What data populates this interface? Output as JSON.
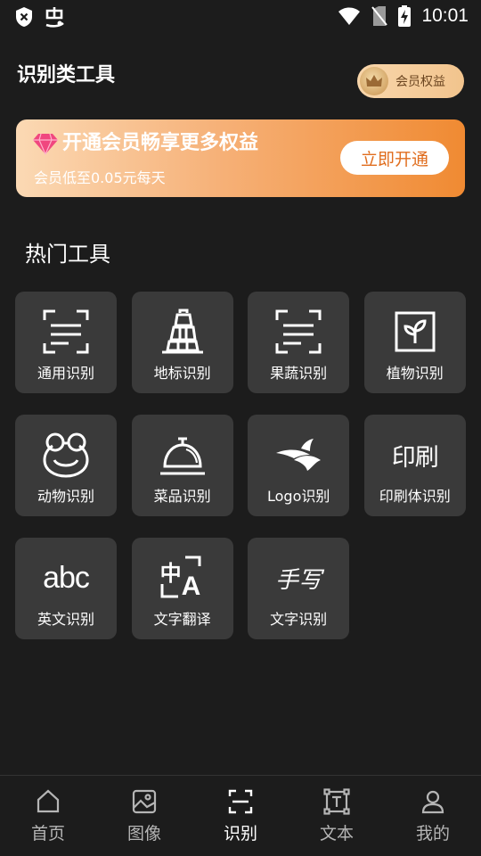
{
  "status_bar": {
    "time": "10:01"
  },
  "header": {
    "title": "识别类工具",
    "member_label": "会员权益"
  },
  "vip_banner": {
    "title": "开通会员畅享更多权益",
    "subtitle": "会员低至0.05元每天",
    "button": "立即开通"
  },
  "section_title": "热门工具",
  "tools": [
    {
      "label": "通用识别",
      "icon": "scan-text-icon"
    },
    {
      "label": "地标识别",
      "icon": "tower-icon"
    },
    {
      "label": "果蔬识别",
      "icon": "scan-text-icon"
    },
    {
      "label": "植物识别",
      "icon": "plant-icon"
    },
    {
      "label": "动物识别",
      "icon": "frog-icon"
    },
    {
      "label": "菜品识别",
      "icon": "dish-cloche-icon"
    },
    {
      "label": "Logo识别",
      "icon": "logo-bird-icon"
    },
    {
      "label": "印刷体识别",
      "icon": "print-text-icon"
    },
    {
      "label": "英文识别",
      "icon": "abc-icon"
    },
    {
      "label": "文字翻译",
      "icon": "translate-icon"
    },
    {
      "label": "文字识别",
      "icon": "handwriting-icon"
    }
  ],
  "tool_icon_text": {
    "print": "印刷",
    "abc": "abc",
    "hand": "手写",
    "zh": "中",
    "en": "A"
  },
  "bottom_nav": [
    {
      "label": "首页",
      "icon": "home-icon"
    },
    {
      "label": "图像",
      "icon": "image-icon"
    },
    {
      "label": "识别",
      "icon": "scan-icon",
      "active": true
    },
    {
      "label": "文本",
      "icon": "text-box-icon"
    },
    {
      "label": "我的",
      "icon": "profile-icon"
    }
  ]
}
